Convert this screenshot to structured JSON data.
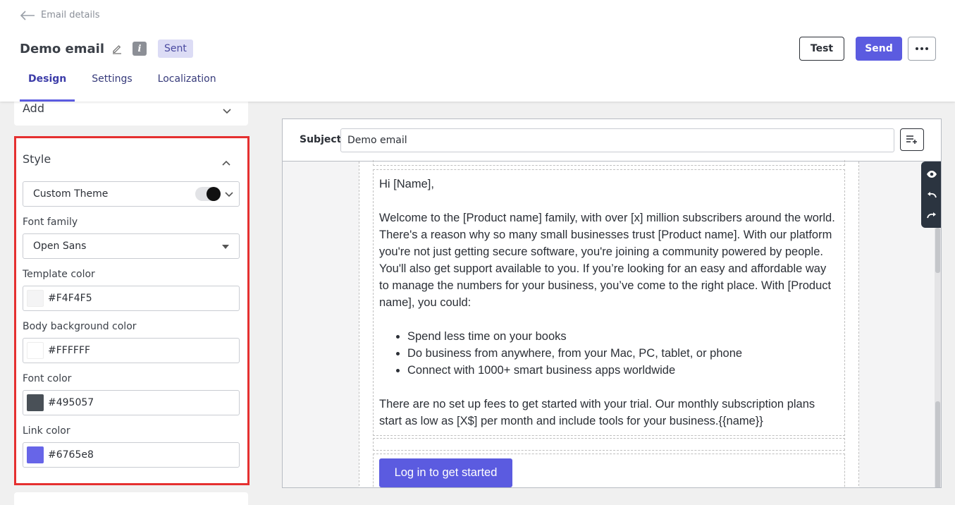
{
  "header": {
    "back_label": "Email details",
    "title": "Demo email",
    "status_badge": "Sent",
    "info_glyph": "i",
    "buttons": {
      "test": "Test",
      "send": "Send"
    }
  },
  "tabs": [
    {
      "label": "Design",
      "active": true
    },
    {
      "label": "Settings",
      "active": false
    },
    {
      "label": "Localization",
      "active": false
    }
  ],
  "sidebar": {
    "add_section": {
      "label": "Add",
      "expanded": false
    },
    "style_section": {
      "label": "Style",
      "expanded": true,
      "theme": {
        "value": "Custom Theme",
        "toggle_on": true
      },
      "font_family": {
        "label": "Font family",
        "value": "Open Sans"
      },
      "template_color": {
        "label": "Template color",
        "value": "#F4F4F5"
      },
      "body_background_color": {
        "label": "Body background color",
        "value": "#FFFFFF"
      },
      "font_color": {
        "label": "Font color",
        "value": "#495057"
      },
      "link_color": {
        "label": "Link color",
        "value": "#6765e8"
      }
    }
  },
  "editor": {
    "subject_label": "Subject",
    "subject_value": "Demo email",
    "email": {
      "greeting": "Hi [Name],",
      "paragraph1": "Welcome to the [Product name] family, with over [x] million subscribers around the world. There's a reason why so many small businesses trust [Product name]. With our platform you're not just getting secure software, you're joining a community powered by people. You'll also get support available to you.   If you’re looking for an easy and affordable way to manage the numbers for your business, you’ve come to the right place. With [Product name], you could:",
      "bullets": [
        "Spend less time on your books",
        "Do business from anywhere, from your Mac, PC, tablet, or phone",
        "Connect with 1000+ smart business apps worldwide"
      ],
      "paragraph2": "There are no set up fees to get started with your trial. Our monthly subscription plans start as low as [X$] per month and include tools for your business.{{name}}",
      "cta_label": "Log in to get started"
    },
    "toolbar_icons": [
      "eye-icon",
      "undo-icon",
      "redo-icon"
    ]
  },
  "colors": {
    "accent": "#5b5be0",
    "highlight_border": "#e53030",
    "badge_bg": "#dcdcf5",
    "toolbar_bg": "#2b3440"
  }
}
